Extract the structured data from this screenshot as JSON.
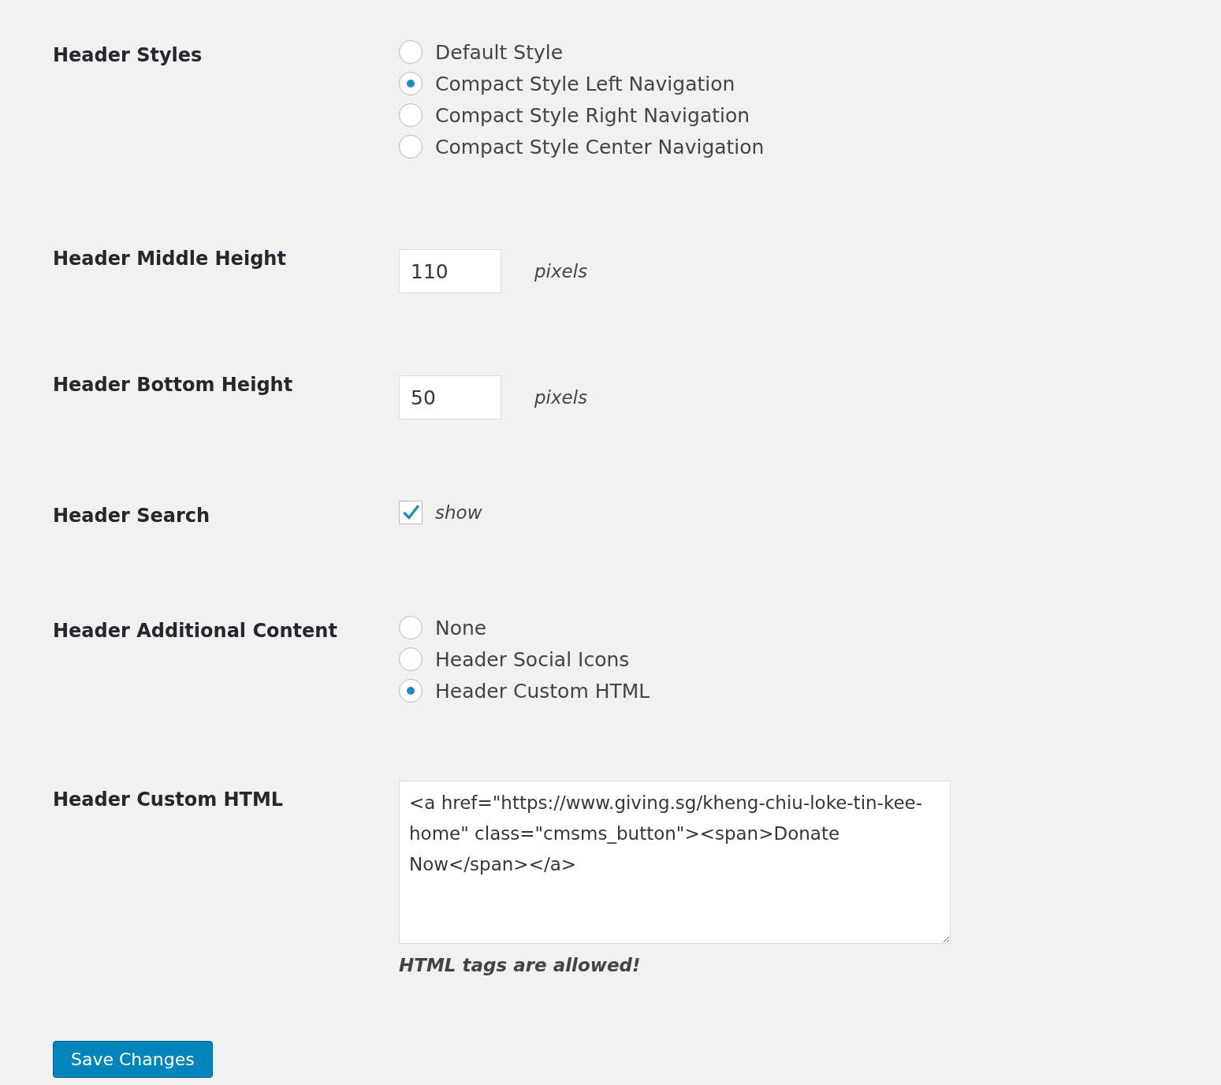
{
  "settings": [
    {
      "kind": "radio",
      "label": "Header Styles",
      "options": [
        {
          "label": "Default Style",
          "selected": false
        },
        {
          "label": "Compact Style Left Navigation",
          "selected": true
        },
        {
          "label": "Compact Style Right Navigation",
          "selected": false
        },
        {
          "label": "Compact Style Center Navigation",
          "selected": false
        }
      ]
    },
    {
      "kind": "number",
      "label": "Header Middle Height",
      "value": "110",
      "unit": "pixels"
    },
    {
      "kind": "number",
      "label": "Header Bottom Height",
      "value": "50",
      "unit": "pixels"
    },
    {
      "kind": "checkbox",
      "label": "Header Search",
      "checked": true,
      "text": "show"
    },
    {
      "kind": "radio",
      "label": "Header Additional Content",
      "options": [
        {
          "label": "None",
          "selected": false
        },
        {
          "label": "Header Social Icons",
          "selected": false
        },
        {
          "label": "Header Custom HTML",
          "selected": true
        }
      ]
    },
    {
      "kind": "textarea",
      "label": "Header Custom HTML",
      "value": "<a href=\"https://www.giving.sg/kheng-chiu-loke-tin-kee-home\" class=\"cmsms_button\"><span>Donate Now</span></a>",
      "description": "HTML tags are allowed!"
    }
  ],
  "save_button": "Save Changes"
}
